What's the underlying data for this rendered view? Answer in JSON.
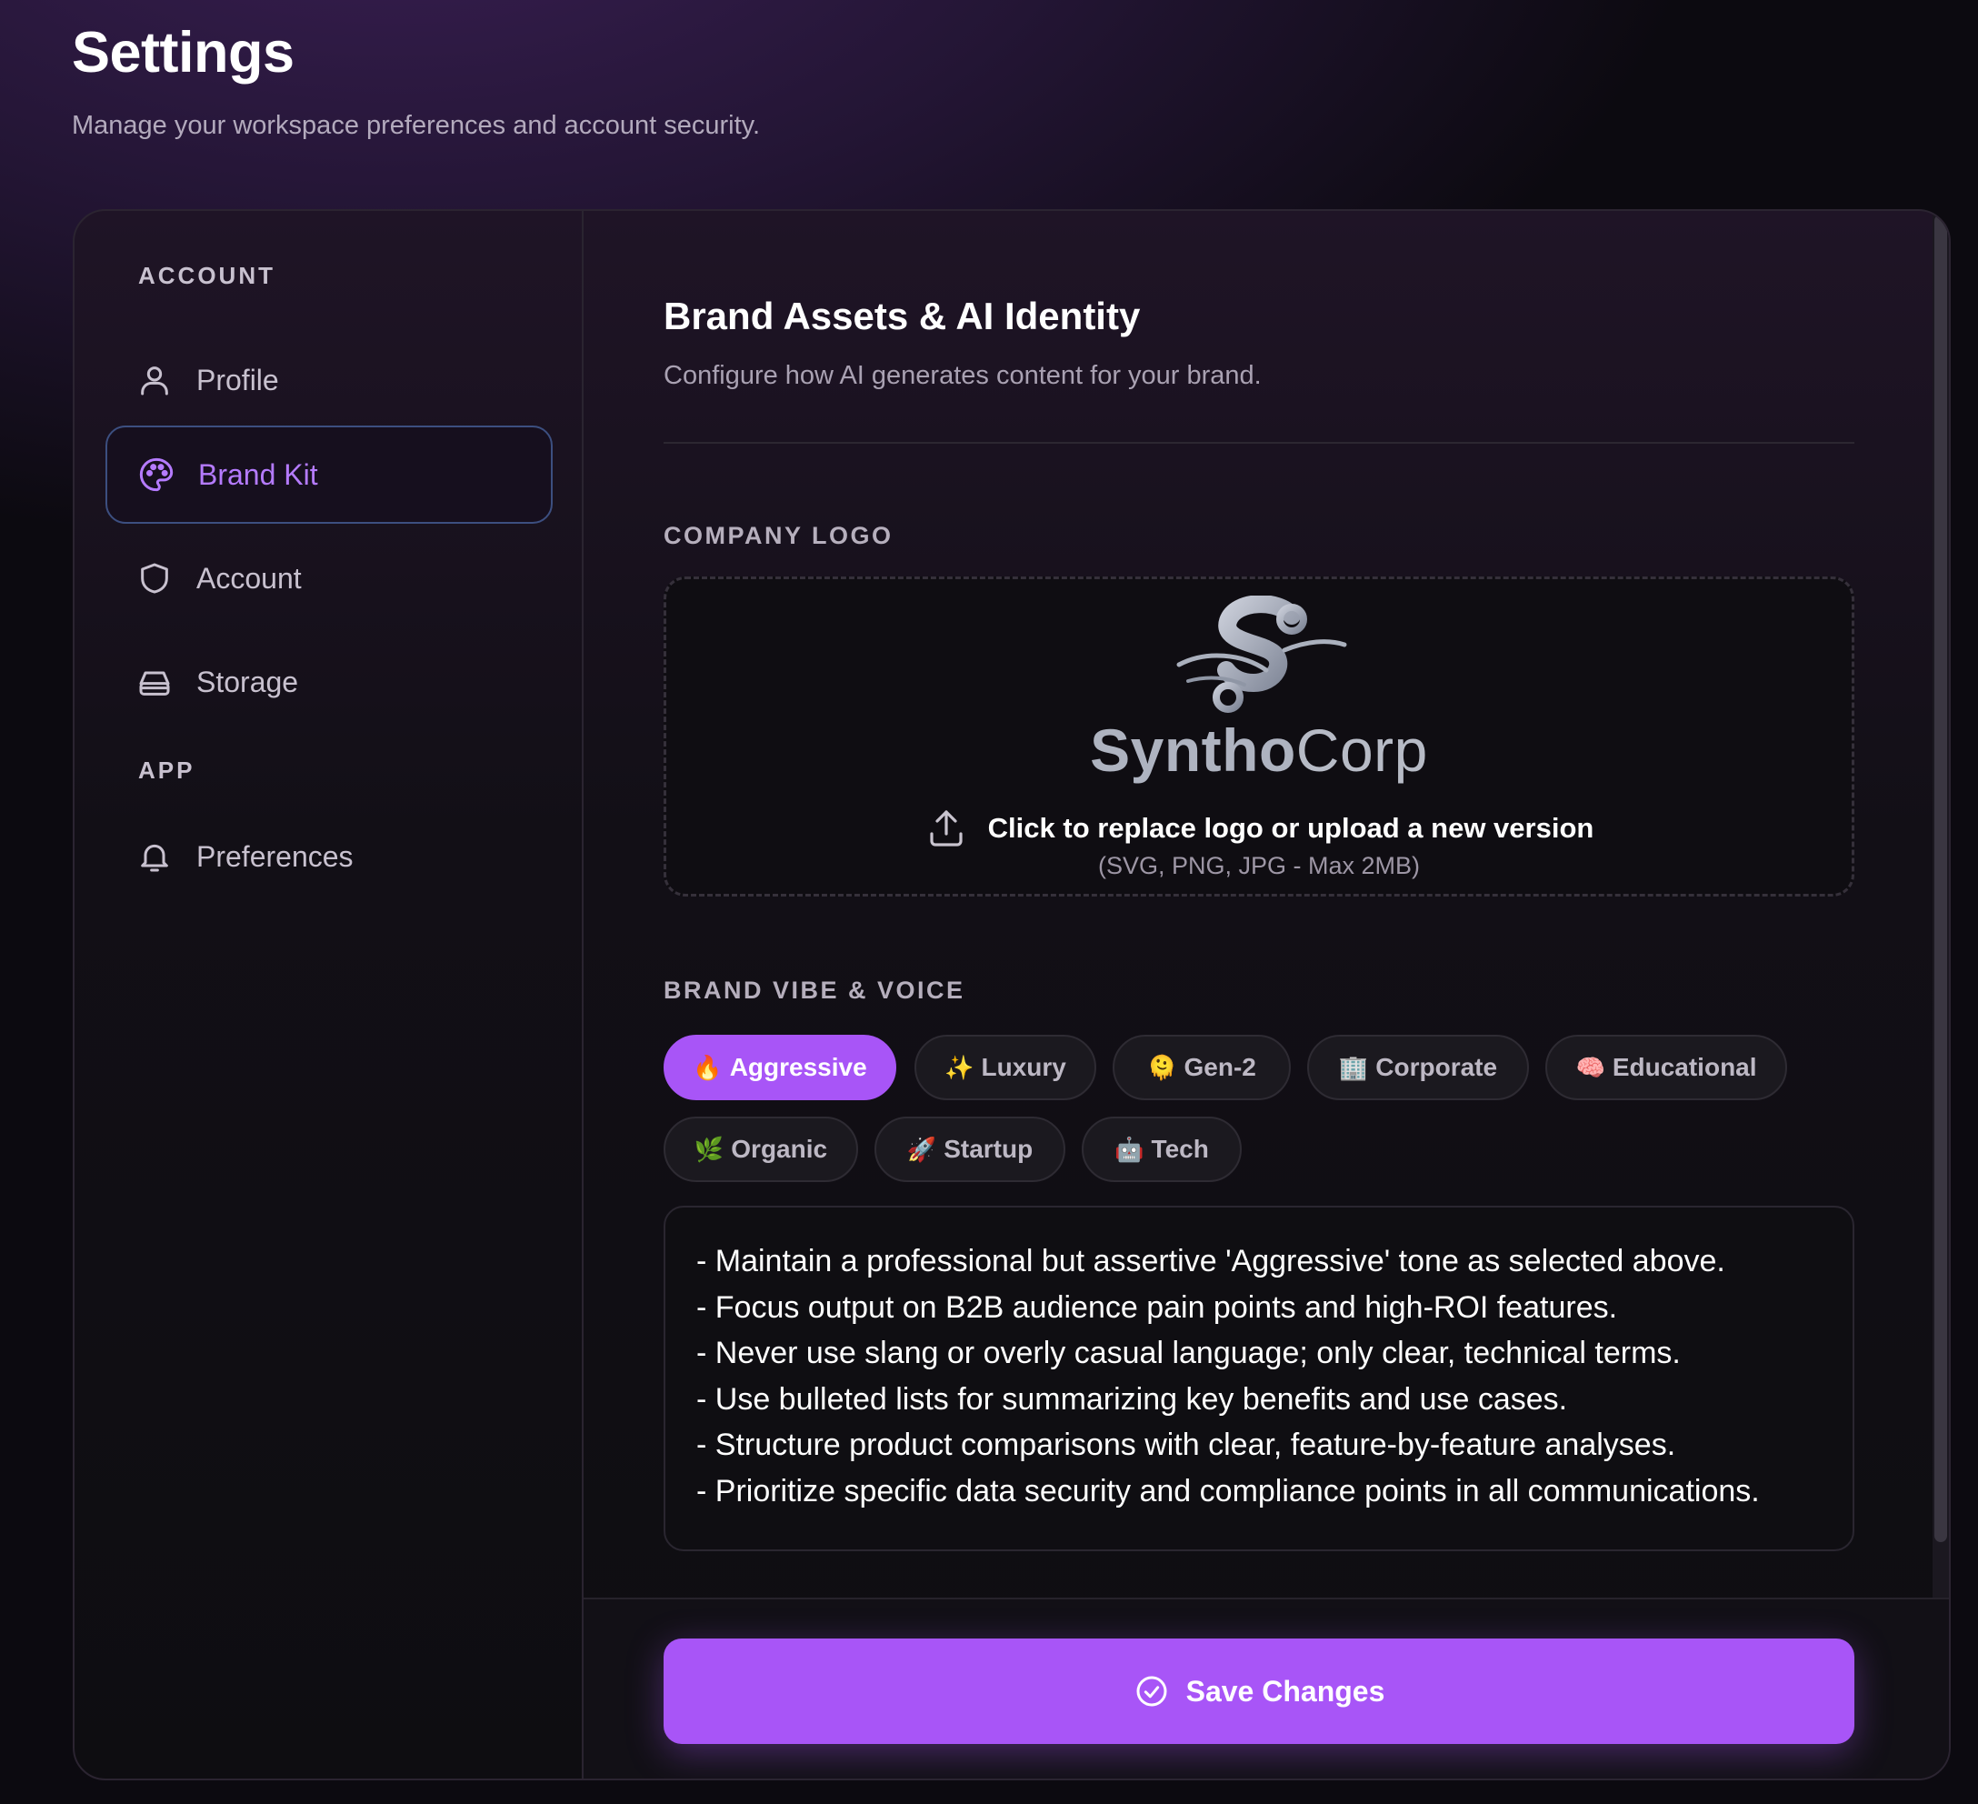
{
  "header": {
    "title": "Settings",
    "subtitle": "Manage your workspace preferences and account security."
  },
  "sidebar": {
    "sections": [
      {
        "label": "ACCOUNT",
        "items": [
          {
            "label": "Profile",
            "icon": "user-icon"
          },
          {
            "label": "Brand Kit",
            "icon": "palette-icon",
            "active": true
          },
          {
            "label": "Account",
            "icon": "shield-icon"
          },
          {
            "label": "Storage",
            "icon": "hard-drive-icon"
          }
        ]
      },
      {
        "label": "APP",
        "items": [
          {
            "label": "Preferences",
            "icon": "bell-icon"
          }
        ]
      }
    ]
  },
  "main": {
    "title": "Brand Assets & AI Identity",
    "subtitle": "Configure how AI generates content for your brand.",
    "logo_section": {
      "label": "COMPANY LOGO",
      "brand_bold": "Syntho",
      "brand_light": "Corp",
      "upload_text": "Click to replace logo or upload a new version",
      "upload_hint": "(SVG, PNG, JPG - Max 2MB)"
    },
    "vibe_section": {
      "label": "BRAND VIBE & VOICE",
      "chips": [
        {
          "emoji": "🔥",
          "label": "Aggressive",
          "selected": true
        },
        {
          "emoji": "✨",
          "label": "Luxury",
          "selected": false
        },
        {
          "emoji": "🫠",
          "label": "Gen-2",
          "selected": false
        },
        {
          "emoji": "🏢",
          "label": "Corporate",
          "selected": false
        },
        {
          "emoji": "🧠",
          "label": "Educational",
          "selected": false
        },
        {
          "emoji": "🌿",
          "label": "Organic",
          "selected": false
        },
        {
          "emoji": "🚀",
          "label": "Startup",
          "selected": false
        },
        {
          "emoji": "🤖",
          "label": "Tech",
          "selected": false
        }
      ],
      "guidelines": [
        "- Maintain a professional but assertive 'Aggressive' tone as selected above.",
        "- Focus output on B2B audience pain points and high-ROI features.",
        "- Never use slang or overly casual language; only clear, technical terms.",
        "- Use bulleted lists for summarizing key benefits and use cases.",
        "- Structure product comparisons with clear, feature-by-feature analyses.",
        "- Prioritize specific data security and compliance points in all communications."
      ]
    }
  },
  "footer": {
    "save_label": "Save Changes",
    "save_icon": "check-circle-icon"
  },
  "colors": {
    "accent": "#a855f7",
    "active_nav_text": "#b57bff",
    "active_nav_border": "#3c4f80"
  }
}
